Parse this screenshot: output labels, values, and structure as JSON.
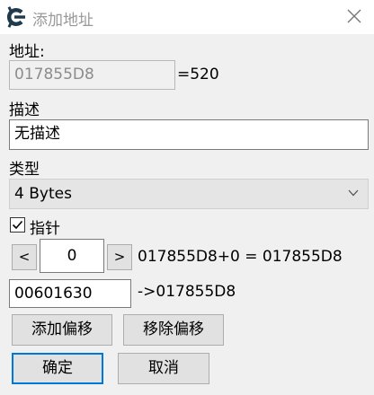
{
  "window": {
    "title": "添加地址"
  },
  "address": {
    "label": "地址:",
    "value": "017855D8",
    "computed": "=520"
  },
  "description": {
    "label": "描述",
    "value": "无描述"
  },
  "type": {
    "label": "类型",
    "selected": "4 Bytes"
  },
  "pointer": {
    "checkbox_label": "指针",
    "checked": true,
    "decrement_label": "<",
    "increment_label": ">",
    "offset_value": "0",
    "offset_result": "017855D8+0 = 017855D8",
    "base_value": "00601630",
    "base_result": "->017855D8"
  },
  "actions": {
    "add_offset": "添加偏移",
    "remove_offset": "移除偏移",
    "ok": "确定",
    "cancel": "取消"
  },
  "colors": {
    "accent": "#0078d7",
    "app_icon": "#1e3a4c"
  }
}
